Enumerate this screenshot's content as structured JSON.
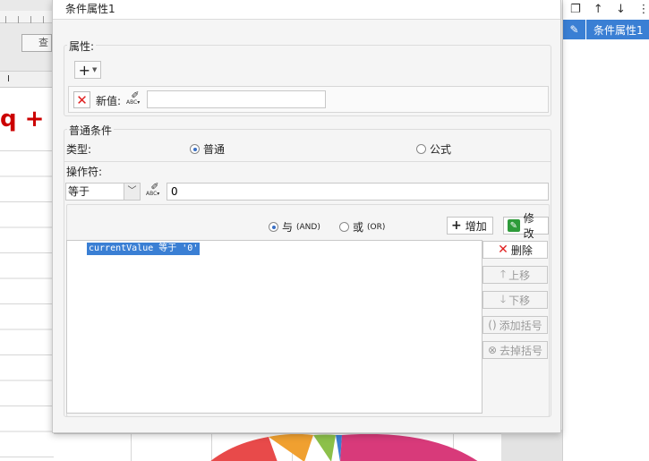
{
  "background": {
    "query_button": "查",
    "column_header": "I",
    "formula_glyph": "q +"
  },
  "side_panel": {
    "toolbar_icons": [
      "copy-icon",
      "arrow-up-icon",
      "arrow-down-icon",
      "more-icon"
    ],
    "item_label": "条件属性1",
    "accent": "#3a7fd4"
  },
  "dialog": {
    "title": "条件属性1",
    "attributes": {
      "title": "属性:",
      "add_label": "+",
      "row": {
        "label": "新值:",
        "value": ""
      }
    },
    "normal_condition": {
      "title": "普通条件",
      "type_label": "类型:",
      "type_options": [
        {
          "label": "普通",
          "selected": true
        },
        {
          "label": "公式",
          "selected": false
        }
      ],
      "operator_label": "操作符:",
      "operator_value": "等于",
      "operand_value": "0",
      "logic_options": [
        {
          "label": "与",
          "en": "(AND)",
          "selected": true
        },
        {
          "label": "或",
          "en": "(OR)",
          "selected": false
        }
      ],
      "add_button": "增加",
      "modify_button": "修改",
      "conditions": [
        "currentValue 等于 '0'"
      ],
      "buttons": {
        "delete": "删除",
        "move_up": "上移",
        "move_down": "下移",
        "add_parens": "添加括号",
        "remove_parens": "去掉括号"
      }
    }
  },
  "colors": {
    "selection": "#3a7fd4",
    "delete_red": "#e02020",
    "edit_green": "#2e9b3a"
  }
}
